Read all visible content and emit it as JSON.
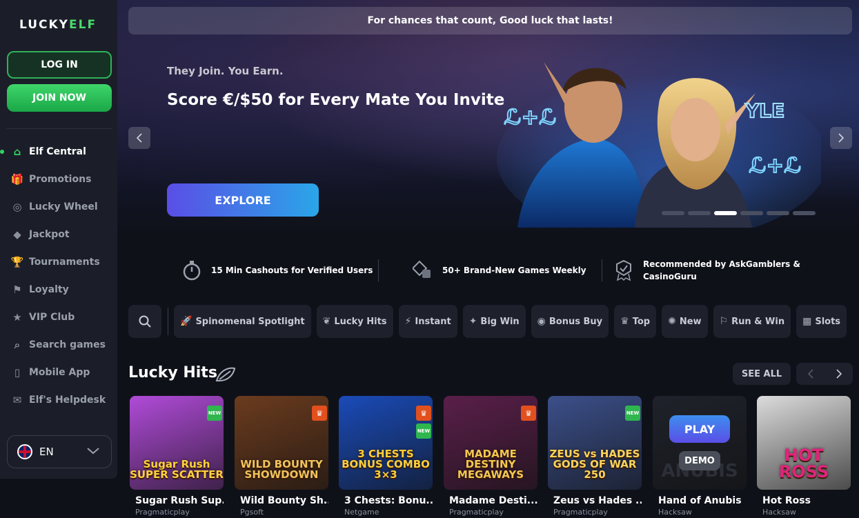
{
  "brand": {
    "logo_text_a": "LUCKY",
    "logo_text_b": "ELF"
  },
  "auth": {
    "login_label": "LOG IN",
    "join_label": "JOIN NOW"
  },
  "nav": [
    {
      "label": "Elf Central",
      "icon": "home-icon",
      "active": true
    },
    {
      "label": "Promotions",
      "icon": "gift-icon"
    },
    {
      "label": "Lucky Wheel",
      "icon": "wheel-icon"
    },
    {
      "label": "Jackpot",
      "icon": "diamond-icon"
    },
    {
      "label": "Tournaments",
      "icon": "trophy-icon"
    },
    {
      "label": "Loyalty",
      "icon": "flag-icon"
    },
    {
      "label": "VIP Club",
      "icon": "star-icon"
    },
    {
      "label": "Search games",
      "icon": "search-icon"
    },
    {
      "label": "Mobile App",
      "icon": "mobile-icon"
    },
    {
      "label": "Elf's Helpdesk",
      "icon": "chat-icon"
    }
  ],
  "language": {
    "code": "EN",
    "flag": "uk-flag-icon"
  },
  "banner": {
    "tagline": "For chances that count, Good luck that lasts!",
    "kicker": "They Join. You Earn.",
    "headline": "Score €/$50 for Every Mate You Invite",
    "cta": "EXPLORE",
    "slides_total": 6,
    "slide_active": 3,
    "art_badge_a": "ℒ+ℒ",
    "art_badge_b": "YLE"
  },
  "features": [
    {
      "icon": "stopwatch-icon",
      "text": "15 Min Cashouts for Verified Users"
    },
    {
      "icon": "dice-icon",
      "text": "50+ Brand-New Games Weekly"
    },
    {
      "icon": "award-badge-icon",
      "text_line1": "Recommended by AskGamblers &",
      "text_line2": "CasinoGuru"
    }
  ],
  "categories": [
    {
      "label": "Spinomenal Spotlight",
      "icon": "rocket-icon"
    },
    {
      "label": "Lucky Hits",
      "icon": "leaf-icon"
    },
    {
      "label": "Instant",
      "icon": "instant-icon"
    },
    {
      "label": "Big Win",
      "icon": "bigwin-icon"
    },
    {
      "label": "Bonus Buy",
      "icon": "coins-icon"
    },
    {
      "label": "Top",
      "icon": "crown-icon"
    },
    {
      "label": "New",
      "icon": "new-badge-icon"
    },
    {
      "label": "Run & Win",
      "icon": "flags-icon"
    },
    {
      "label": "Slots",
      "icon": "slot-machine-icon"
    }
  ],
  "section": {
    "title": "Lucky Hits",
    "see_all": "SEE ALL"
  },
  "games": [
    {
      "name": "Sugar Rush Sup...",
      "provider": "Pragmaticplay",
      "badge": "new",
      "badge_text": "NEW",
      "art": "Sugar Rush\nSUPER SCATTER",
      "bg": "#b04bd8",
      "fg": "#ffd23c"
    },
    {
      "name": "Wild Bounty Sh...",
      "provider": "Pgsoft",
      "badge": "crown",
      "art": "WILD BOUNTY\nSHOWDOWN",
      "bg": "#6b3b1e",
      "fg": "#f2c35a"
    },
    {
      "name": "3 Chests: Bonu...",
      "provider": "Netgame",
      "badge": "crown+new",
      "badge_text": "NEW",
      "art": "3 CHESTS\nBONUS COMBO 3×3",
      "bg": "#1a4bb8",
      "fg": "#ffcf3a"
    },
    {
      "name": "Madame Desti...",
      "provider": "Pragmaticplay",
      "badge": "crown",
      "art": "MADAME DESTINY\nMEGAWAYS",
      "bg": "#5a1f4a",
      "fg": "#f4c84e"
    },
    {
      "name": "Zeus vs Hades ...",
      "provider": "Pragmaticplay",
      "badge": "new",
      "badge_text": "NEW",
      "art": "ZEUS vs HADES\nGODS OF WAR 250",
      "bg": "#3b4f8a",
      "fg": "#ffd45a"
    },
    {
      "name": "Hand of Anubis",
      "provider": "Hacksaw",
      "badge": "none",
      "play": "PLAY",
      "demo": "DEMO",
      "art": "ANUBIS",
      "bg": "#1f222b",
      "fg": "#2c2f38"
    },
    {
      "name": "Hot Ross",
      "provider": "Hacksaw",
      "badge": "none",
      "art": "HOT\nROSS",
      "bg": "#dcdcdc",
      "fg": "#e0247a"
    }
  ],
  "colors": {
    "accent_green": "#2fd463",
    "explore_gradient": [
      "#5a4ee6",
      "#2aa6e8"
    ],
    "bg": "#0f1119",
    "panel": "#1b1e28"
  }
}
